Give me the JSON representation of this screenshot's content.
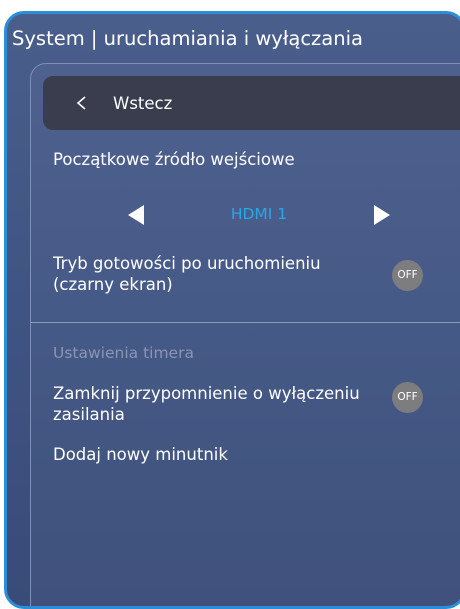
{
  "window": {
    "title": "System | uruchamiania i wyłączania"
  },
  "back": {
    "label": "Wstecz",
    "icon": "chevron-left-icon"
  },
  "input_source": {
    "label": "Początkowe źródło wejściowe",
    "value": "HDMI 1",
    "prev_icon": "triangle-left-icon",
    "next_icon": "triangle-right-icon"
  },
  "standby_after_boot": {
    "label_line1": "Tryb gotowości po uruchomieniu",
    "label_line2": "(czarny ekran)",
    "toggle": "OFF"
  },
  "timer_section": {
    "header": "Ustawienia timera"
  },
  "power_off_reminder": {
    "label_line1": "Zamknij przypomnienie o wyłączeniu",
    "label_line2": "zasilania",
    "toggle": "OFF"
  },
  "add_timer": {
    "label": "Dodaj nowy minutnik"
  },
  "colors": {
    "background": "#42588a",
    "frame_border": "#2a8fd6",
    "back_bar": "#3a3d4d",
    "accent": "#2aa8e6",
    "toggle_off": "#7d7d80",
    "section_header": "#8b95b2"
  }
}
